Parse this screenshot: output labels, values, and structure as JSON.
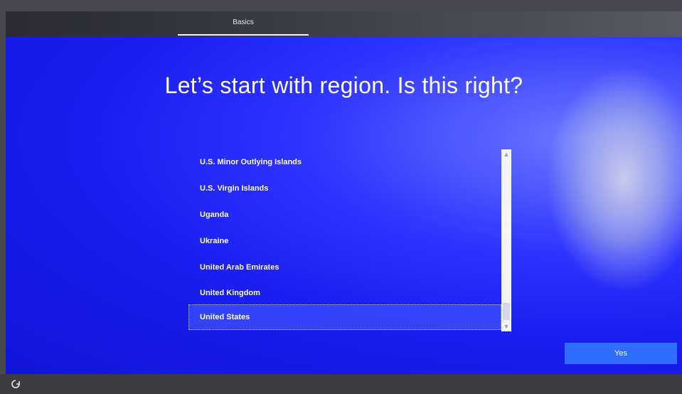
{
  "tabs": [
    {
      "label": "Basics"
    }
  ],
  "main": {
    "heading": "Let’s start with region. Is this right?"
  },
  "region_list": {
    "items": [
      {
        "label": "U.S. Minor Outlying Islands"
      },
      {
        "label": "U.S. Virgin Islands"
      },
      {
        "label": "Uganda"
      },
      {
        "label": "Ukraine"
      },
      {
        "label": "United Arab Emirates"
      },
      {
        "label": "United Kingdom"
      },
      {
        "label": "United States",
        "selected": true
      }
    ]
  },
  "buttons": {
    "yes_label": "Yes"
  },
  "icons": {
    "accessibility": "ease-of-access-icon",
    "scroll_up": "chevron-up-icon",
    "scroll_down": "chevron-down-icon"
  },
  "colors": {
    "background_blue": "#1a1ff0",
    "button_blue": "#2f6cff",
    "text": "#ffffff"
  }
}
